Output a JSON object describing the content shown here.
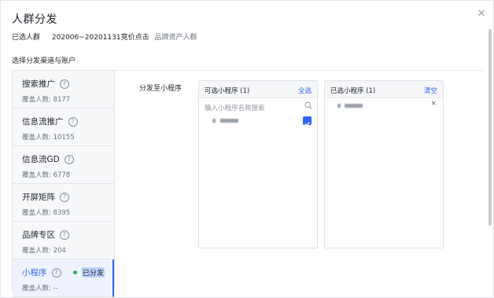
{
  "dialog": {
    "title": "人群分发",
    "close_icon": "close-icon"
  },
  "selected": {
    "label": "已选人群",
    "value": "202006~20201131竞价点击",
    "tag": "品牌资产人群"
  },
  "section_label": "选择分发渠道与账户",
  "channels": [
    {
      "name": "搜索推广",
      "count": "覆盖人数: 8177"
    },
    {
      "name": "信息流推广",
      "count": "覆盖人数: 10155"
    },
    {
      "name": "信息流GD",
      "count": "覆盖人数: 6778"
    },
    {
      "name": "开屏矩阵",
      "count": "覆盖人数: 8395"
    },
    {
      "name": "品牌专区",
      "count": "覆盖人数: 204"
    },
    {
      "name": "小程序",
      "count": "覆盖人数: --",
      "status": "已分发",
      "status_color": "#2fb158"
    }
  ],
  "help_glyph": "?",
  "distribute_label": "分发至小程序",
  "available_panel": {
    "title": "可选小程序 (1)",
    "action": "全选",
    "search_placeholder": "输入小程序名称搜索",
    "items_checked": [
      true
    ]
  },
  "selected_panel": {
    "title": "已选小程序 (1)",
    "action": "清空",
    "remove_glyph": "×"
  },
  "accent_color": "#3366f0"
}
